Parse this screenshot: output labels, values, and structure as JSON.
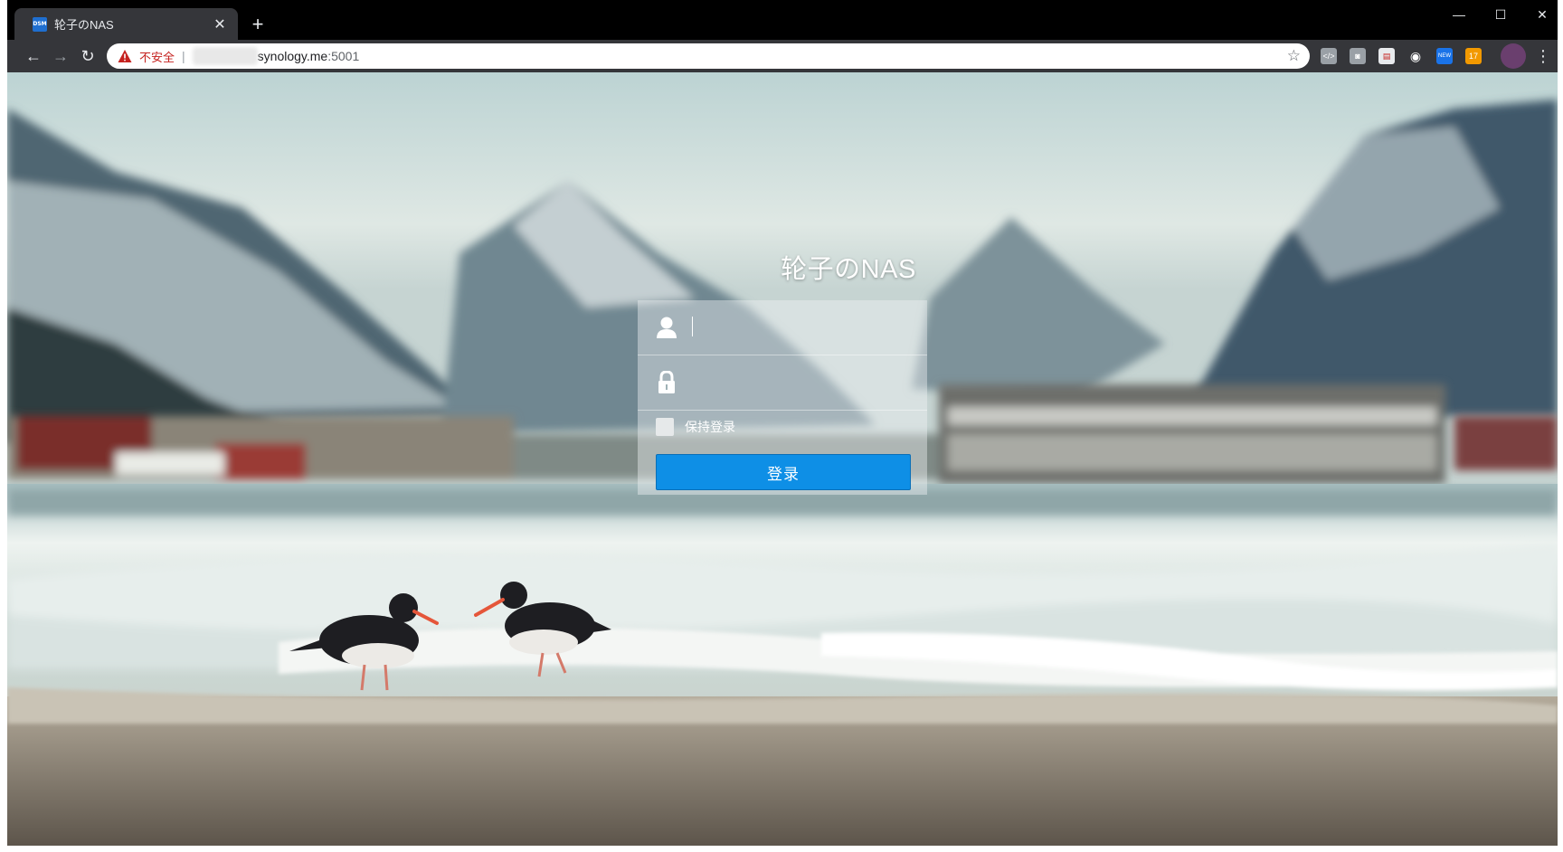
{
  "browser": {
    "tab_title": "轮子のNAS",
    "tab_favicon_text": "DSM",
    "tab_close": "✕",
    "new_tab": "+",
    "window_controls": {
      "minimize": "—",
      "maximize": "☐",
      "close": "✕"
    },
    "nav": {
      "back": "←",
      "forward": "→",
      "reload": "↻"
    },
    "address_bar": {
      "security_label": "不安全",
      "separator": "|",
      "host": "synology.me",
      "port": ":5001"
    },
    "bookmark_star": "☆",
    "extensions": [
      {
        "name": "code-extension-icon",
        "label": "</>",
        "color": "#5f6368"
      },
      {
        "name": "camera-extension-icon",
        "label": "◙",
        "color": "#5f6368"
      },
      {
        "name": "calendar-extension-icon",
        "label": "▤",
        "color": "#ffffff"
      },
      {
        "name": "circle-extension-icon",
        "label": "◉",
        "color": "#ffffff"
      },
      {
        "name": "new-extension-icon",
        "label": "NEW",
        "color": "#1a73e8"
      },
      {
        "name": "rss-extension-icon",
        "label": "17",
        "color": "#f29900"
      }
    ],
    "menu": "⋮"
  },
  "page": {
    "site_title": "轮子のNAS",
    "username_placeholder": "",
    "password_placeholder": "",
    "remember_label": "保持登录",
    "login_button": "登录"
  }
}
